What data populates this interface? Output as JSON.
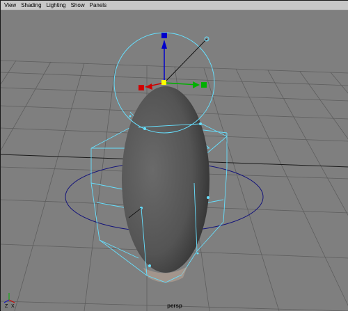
{
  "menubar": {
    "items": [
      "View",
      "Shading",
      "Lighting",
      "Show",
      "Panels"
    ]
  },
  "viewport": {
    "camera_label": "persp",
    "axis": {
      "x": "X",
      "y": "Y",
      "z": "Z"
    }
  },
  "colors": {
    "background": "#7f7f7f",
    "grid": "#5e5e5e",
    "cyan": "#66e0ff",
    "blue_ring": "#14147a",
    "egg_base": "#545454",
    "red_handle": "#d00000",
    "green_handle": "#00b000",
    "blue_handle": "#0000cc",
    "yellow_center": "#ffff00"
  }
}
